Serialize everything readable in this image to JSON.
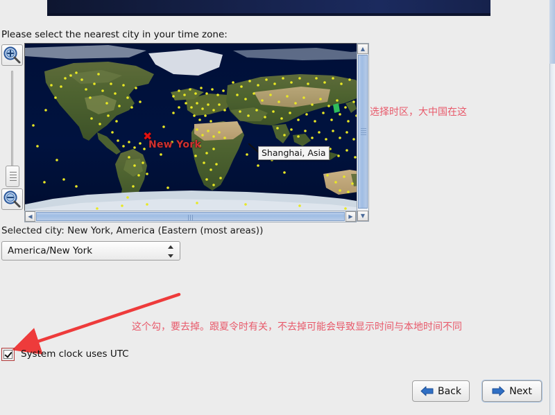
{
  "banner": {
    "name": "installer-header-banner"
  },
  "prompt": "Please select the nearest city in your time zone:",
  "map": {
    "selected_city_marker": "✖",
    "selected_city_label": "New York",
    "tooltip": "Shanghai, Asia",
    "zoom_in_icon": "zoom-in-magnifier",
    "zoom_out_icon": "zoom-out-magnifier"
  },
  "scrollbars": {
    "v_up": "▲",
    "v_down": "▼",
    "h_left": "◀",
    "h_right": "▶"
  },
  "selected_city": "Selected city: New York, America (Eastern (most areas))",
  "timezone_combo": {
    "value": "America/New York",
    "options": [
      "America/New York"
    ]
  },
  "utc": {
    "label": "System clock uses UTC",
    "checked": true
  },
  "annotations": {
    "map_note": "选择时区，大中国在这",
    "checkbox_note": "这个勾，要去掉。跟夏令时有关，不去掉可能会导致显示时间与本地时间不同",
    "color": "#e8596a"
  },
  "footer": {
    "back_label": "Back",
    "next_label": "Next"
  },
  "colors": {
    "page_background": "#ececec",
    "banner": "#16224c",
    "ocean": "#00103a",
    "city_dot": "#e8e824",
    "annotation_red": "#e8596a",
    "marker_red": "#e01010",
    "scrollbar_thumb": "#9fbde4"
  }
}
